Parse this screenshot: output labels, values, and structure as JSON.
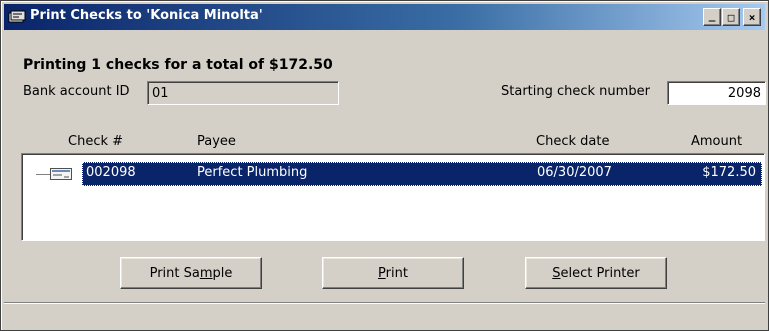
{
  "window": {
    "title": "Print Checks to 'Konica Minolta'",
    "controls": {
      "minimize": "_",
      "maximize": "□",
      "close": "×"
    }
  },
  "summary": "Printing 1 checks for a total of $172.50",
  "bank_account": {
    "label": "Bank account ID",
    "value": "01"
  },
  "starting_check": {
    "label": "Starting check number",
    "value": "2098"
  },
  "columns": {
    "check_no": "Check #",
    "payee": "Payee",
    "check_date": "Check date",
    "amount": "Amount"
  },
  "checks": [
    {
      "check_no": "002098",
      "payee": "Perfect Plumbing",
      "check_date": "06/30/2007",
      "amount": "$172.50",
      "selected": true
    }
  ],
  "buttons": {
    "print_sample": {
      "before": "Print Sa",
      "mnemonic": "m",
      "after": "ple"
    },
    "print": {
      "before": "",
      "mnemonic": "P",
      "after": "rint"
    },
    "select_printer": {
      "before": "",
      "mnemonic": "S",
      "after": "elect Printer"
    }
  },
  "colors": {
    "title_gradient_start": "#0a246a",
    "title_gradient_end": "#a6caf0",
    "selection": "#0a246a",
    "face": "#d4d0c8"
  },
  "icons": {
    "title": "checks-app-icon",
    "row": "check-document-icon"
  }
}
